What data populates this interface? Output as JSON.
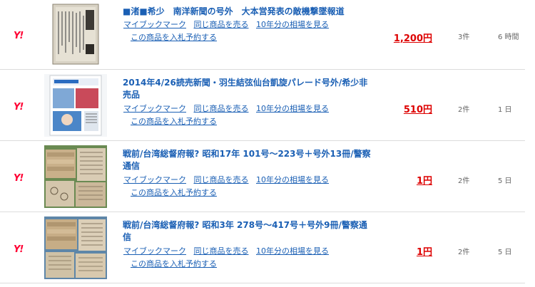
{
  "icons": {
    "auction_site": "yahoo-auction-icon"
  },
  "common": {
    "mybookmark": "マイブックマーク",
    "sell_same": "同じ商品を売る",
    "market_10y": "10年分の相場を見る",
    "reserve_bid": "この商品を入札予約する"
  },
  "items": [
    {
      "title": "■渚■希少　南洋新聞の号外　大本営発表の敵機撃墜報道",
      "price": "1,200円",
      "bids": "3件",
      "time_left": "6 時間",
      "thumb_desc": "newspaper-extra-photo"
    },
    {
      "title": "2014年4/26読売新聞・羽生結弦仙台凱旋パレード号外/希少非売品",
      "price": "510円",
      "bids": "2件",
      "time_left": "1 日",
      "thumb_desc": "newspaper-extra-photo"
    },
    {
      "title": "戦前/台湾総督府報? 昭和17年 101号～223号＋号外13冊/警察通信",
      "price": "1円",
      "bids": "2件",
      "time_left": "5 日",
      "thumb_desc": "document-bundle-photo"
    },
    {
      "title": "戦前/台湾総督府報? 昭和3年 278号～417号＋号外9冊/警察通信",
      "price": "1円",
      "bids": "2件",
      "time_left": "5 日",
      "thumb_desc": "document-bundle-photo"
    }
  ],
  "colors": {
    "link": "#1a5fb4",
    "price": "#dd0000",
    "yahoo_red": "#ff0033",
    "divider": "#dcdcdc",
    "muted": "#666666"
  }
}
